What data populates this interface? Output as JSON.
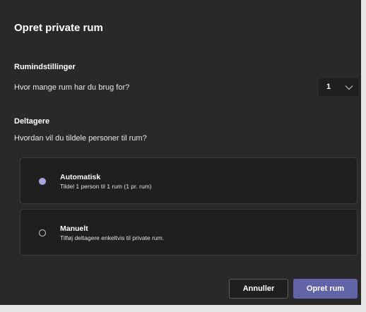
{
  "dialog": {
    "title": "Opret private rum"
  },
  "room_settings": {
    "label": "Rumindstillinger",
    "question": "Hvor mange rum har du brug for?",
    "rooms_value": "1"
  },
  "participants": {
    "label": "Deltagere",
    "question": "Hvordan vil du tildele personer til rum?",
    "options": [
      {
        "title": "Automatisk",
        "description": "Tildel 1 person til 1 rum (1 pr. rum)",
        "selected": true
      },
      {
        "title": "Manuelt",
        "description": "Tilføj deltagere enkeltvis til private rum.",
        "selected": false
      }
    ]
  },
  "footer": {
    "cancel_label": "Annuller",
    "create_label": "Opret rum"
  },
  "colors": {
    "background": "#292929",
    "accent": "#6264a7",
    "radio_selected": "#a6a3e3"
  },
  "icons": {
    "dropdown": "chevron-down-icon",
    "radio_selected": "radio-selected-icon",
    "radio_unselected": "radio-unselected-icon"
  }
}
